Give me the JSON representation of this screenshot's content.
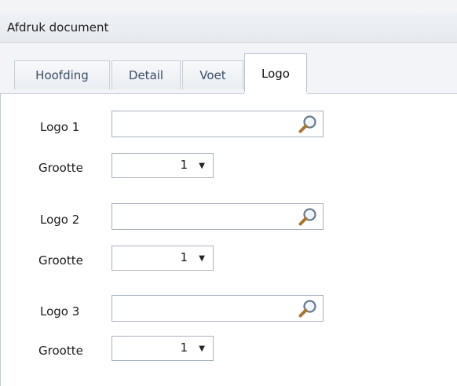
{
  "panel": {
    "title": "Afdruk document"
  },
  "tabs": [
    {
      "label": "Hoofding",
      "active": false
    },
    {
      "label": "Detail",
      "active": false
    },
    {
      "label": "Voet",
      "active": false
    },
    {
      "label": "Logo",
      "active": true
    }
  ],
  "logos": [
    {
      "label": "Logo 1",
      "value": "",
      "size_label": "Grootte",
      "size_value": "1",
      "size_arrow": "▼"
    },
    {
      "label": "Logo 2",
      "value": "",
      "size_label": "Grootte",
      "size_value": "1",
      "size_arrow": "▼"
    },
    {
      "label": "Logo 3",
      "value": "",
      "size_label": "Grootte",
      "size_value": "1",
      "size_arrow": "▼"
    }
  ],
  "icons": {
    "browse": "search-icon",
    "dropdown": "chevron-down-icon"
  }
}
